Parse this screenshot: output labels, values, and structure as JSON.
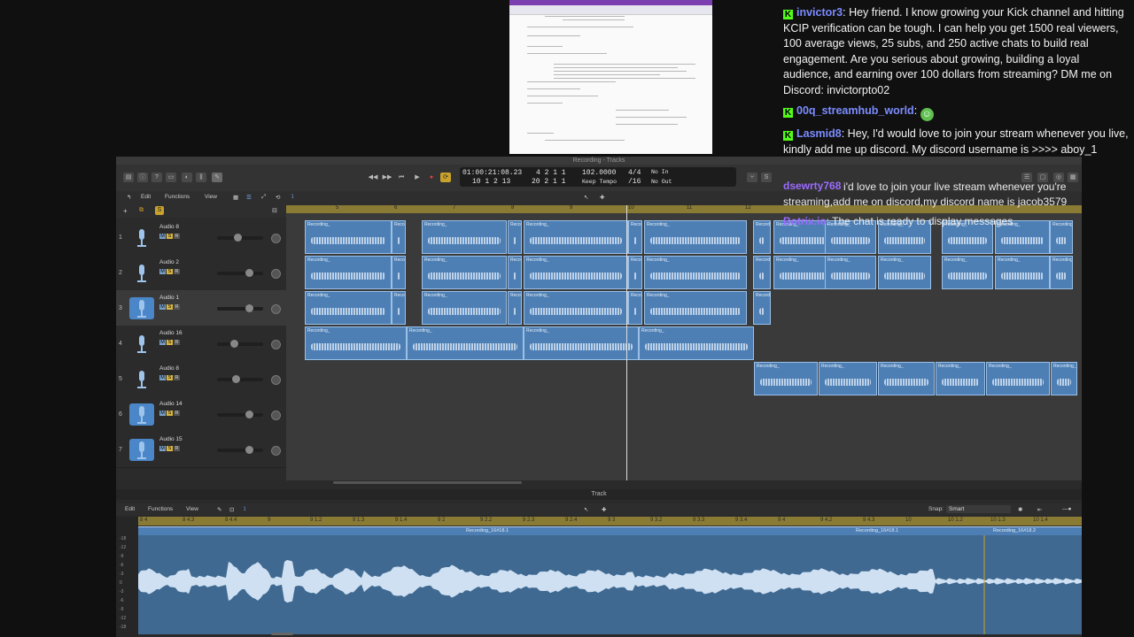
{
  "chat": [
    {
      "user": "invictor3",
      "color": "#7b8cff",
      "text": "Hey friend. I know growing your Kick channel and hitting KCIP verification can be tough. I can help you get 1500 real viewers, 100 average views, 25 subs, and 250 active chats to build real engagement. Are you serious about growing, building a loyal audience, and earning over 100 dollars from streaming? DM me on Discord: invictorpto02"
    },
    {
      "user": "00q_streamhub_world",
      "color": "#7b8cff",
      "text": ""
    },
    {
      "user": "Lasmid8",
      "color": "#7b8cff",
      "text": "Hey, I'd would love to join your stream whenever you live, kindly add me up discord. My discord username is >>>> aboy_1"
    },
    {
      "user": "dsewrty768",
      "color": "#9b6cff",
      "text": "i'd love to join your live stream whenever you're streaming,add me on discord,my discord name is jacob3579"
    },
    {
      "user": "Botrix.io",
      "color": "#9b6cff",
      "text": "The chat is ready to display messages"
    }
  ],
  "daw": {
    "window_title": "Recording - Tracks",
    "edit_menu": "Edit",
    "functions_menu": "Functions",
    "view_menu": "View",
    "lcd": {
      "time": "01:00:21:08.23",
      "bars_top": "4  2  1     1",
      "bars_bottom": "10  1  2   13",
      "pos2_top": "",
      "pos2_bottom": "20  2  1     1",
      "tempo": "102.0000",
      "tempo_label": "Keep Tempo",
      "sig_top": "4/4",
      "sig_bottom": "/16",
      "in_label": "No In",
      "out_label": "No Out"
    },
    "tracks": [
      {
        "num": "1",
        "name": "Audio 8",
        "selected": false,
        "fader": 0.45
      },
      {
        "num": "2",
        "name": "Audio 2",
        "selected": false,
        "fader": 0.75
      },
      {
        "num": "3",
        "name": "Audio 1",
        "selected": true,
        "fader": 0.75
      },
      {
        "num": "4",
        "name": "Audio 16",
        "selected": false,
        "fader": 0.35
      },
      {
        "num": "5",
        "name": "Audio 8",
        "selected": false,
        "fader": 0.4
      },
      {
        "num": "6",
        "name": "Audio 14",
        "selected": true,
        "fader": 0.75
      },
      {
        "num": "7",
        "name": "Audio 15",
        "selected": true,
        "fader": 0.75
      }
    ],
    "ruler_marks": [
      "5",
      "6",
      "7",
      "8",
      "9",
      "10",
      "11",
      "12"
    ],
    "region_label": "Recording_",
    "editor": {
      "title": "Track",
      "edit_menu": "Edit",
      "functions_menu": "Functions",
      "view_menu": "View",
      "snap_label": "Snap:",
      "snap_value": "Smart",
      "ruler_marks": [
        "8 4",
        "8 4.3",
        "8 4.4",
        "9",
        "9 1.2",
        "9 1.3",
        "9 1.4",
        "9 2",
        "9 2.2",
        "9 2.3",
        "9 2.4",
        "9 3",
        "9 3.2",
        "9 3.3",
        "9 3.4",
        "9 4",
        "9 4.2",
        "9 4.3",
        "10",
        "10 1.2",
        "10 1.3",
        "10 1.4"
      ],
      "region_labels": [
        "Recording_16#18.1",
        "Recording_16#18.1",
        "Recording_16#18.2"
      ],
      "db_labels": [
        "-18",
        "-12",
        "-9",
        "-6",
        "-3",
        "0",
        "-3",
        "-6",
        "-9",
        "-12",
        "-18"
      ]
    }
  }
}
